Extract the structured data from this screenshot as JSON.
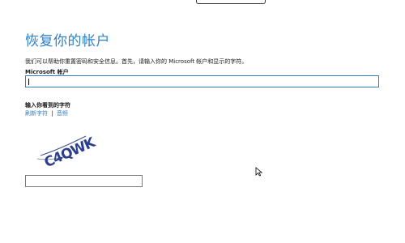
{
  "page": {
    "title": "恢复你的帐户",
    "description": "我们可以帮助你重置密码和安全信息。首先，请输入你的 Microsoft 帐户和显示的字符。"
  },
  "account_field": {
    "label": "Microsoft 帐户",
    "value": ""
  },
  "captcha": {
    "label": "输入你看到的字符",
    "new_characters_link": "刷新字符",
    "separator": "|",
    "audio_link": "音频",
    "image_text": "C4QWK",
    "input_value": ""
  },
  "colors": {
    "accent": "#2f80c8",
    "text": "#1a1a1a",
    "captcha_ink": "#2b3f8e"
  }
}
